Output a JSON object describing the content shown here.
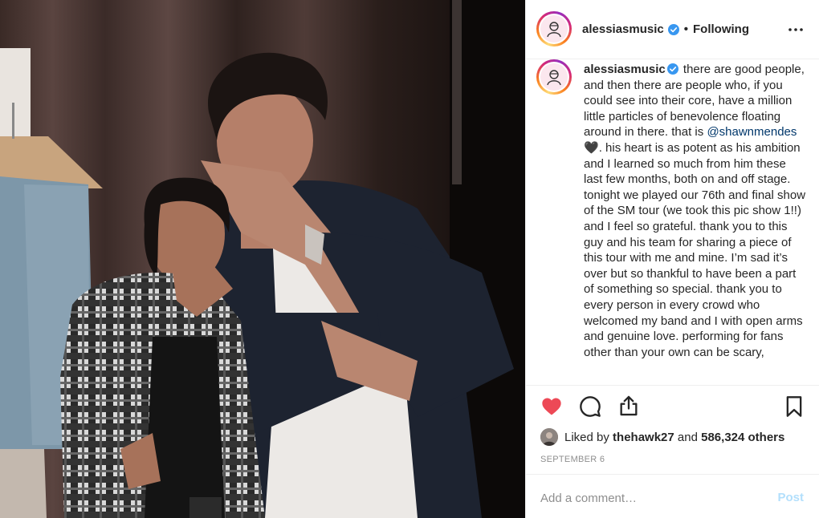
{
  "post": {
    "username": "alessiasmusic",
    "follow_separator": "•",
    "follow_status": "Following",
    "more_icon": "more-horizontal-icon",
    "verified_color": "#3897f0"
  },
  "caption": {
    "username": "alessiasmusic",
    "text_before_mention": "there are good people, and then there are people who, if you could see into their core, have a million little particles of benevolence floating around in there. that is",
    "mention": "@shawnmendes",
    "emoji": "🖤",
    "text_after_mention": ". his heart is as potent as his ambition and I learned so much from him these last few months, both on and off stage. tonight we played our 76th and final show of the SM tour (we took this pic show 1!!) and I feel so grateful. thank you to this guy and his team for sharing a piece of this tour with me and mine. I’m sad it’s over but so thankful to have been a part of something so special. thank you to every person in every crowd who welcomed my band and I with open arms and genuine love. performing for fans other than your own can be scary,"
  },
  "actions": {
    "like_icon": "heart-filled-icon",
    "like_color": "#ed4956",
    "comment_icon": "comment-bubble-icon",
    "share_icon": "share-upload-icon",
    "save_icon": "bookmark-icon"
  },
  "likes": {
    "prefix": "Liked by",
    "user": "thehawk27",
    "and": "and",
    "others": "586,324 others"
  },
  "date": "SEPTEMBER 6",
  "comment": {
    "placeholder": "Add a comment…",
    "post_label": "Post"
  }
}
